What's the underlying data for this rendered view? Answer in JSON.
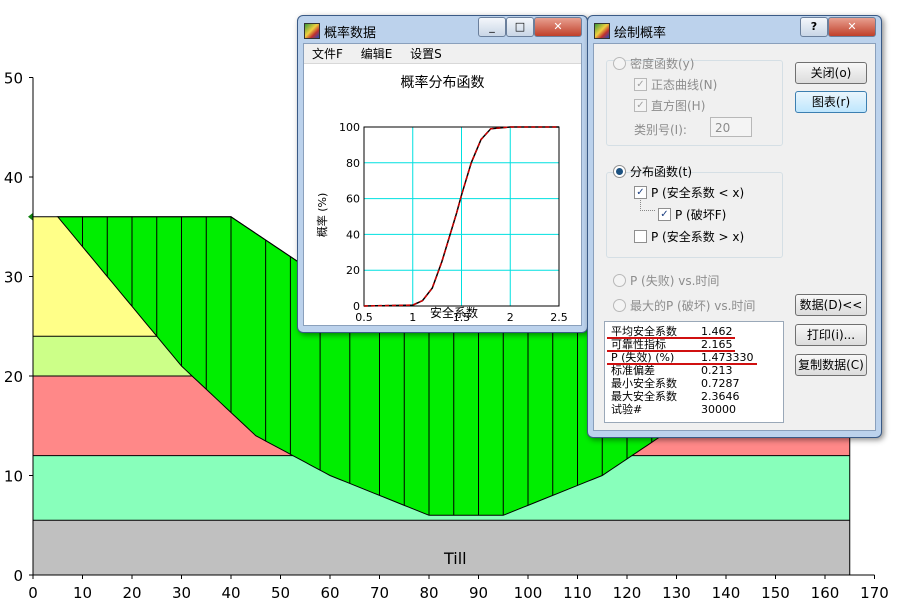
{
  "chart_data": {
    "type": "area",
    "x_ticks": [
      "0",
      "10",
      "20",
      "30",
      "40",
      "50",
      "60",
      "70",
      "80",
      "90",
      "100",
      "110",
      "120",
      "130",
      "140",
      "150",
      "160",
      "170"
    ],
    "y_ticks": [
      "0",
      "10",
      "20",
      "30",
      "40",
      "50"
    ],
    "xlim": [
      0,
      170
    ],
    "ylim": [
      0,
      50
    ],
    "layers": [
      {
        "color": "#ffff88",
        "top_y": 36
      },
      {
        "color": "#ccff88",
        "top_y": 24
      },
      {
        "color": "#ff8888",
        "top_y": 20
      },
      {
        "color": "#88ffbb",
        "top_y": 12
      },
      {
        "color": "#c0c0c0",
        "top_y": 5.5
      }
    ],
    "ground_surface": [
      [
        0,
        36
      ],
      [
        40,
        36
      ],
      [
        58,
        30
      ],
      [
        130,
        30
      ],
      [
        135,
        24
      ],
      [
        165,
        24
      ]
    ],
    "slip_surface": [
      [
        5,
        36
      ],
      [
        15,
        30
      ],
      [
        30,
        21
      ],
      [
        45,
        14
      ],
      [
        60,
        10
      ],
      [
        80,
        6
      ],
      [
        95,
        6
      ],
      [
        115,
        10
      ],
      [
        130,
        15
      ],
      [
        150,
        24
      ]
    ],
    "slice_x": [
      5,
      10,
      15,
      20,
      25,
      30,
      35,
      40,
      47,
      52,
      58,
      64,
      70,
      75,
      80,
      85,
      90,
      95,
      100,
      105,
      110,
      115,
      120,
      125,
      130,
      135,
      140,
      145,
      150
    ],
    "slip_color": "#00ee00",
    "bedrock_label": "Till",
    "cdf_chart": {
      "title": "概率分布函数",
      "xlabel": "安全系数",
      "ylabel": "概率 (%)",
      "x_ticks": [
        "0.5",
        "1",
        "1.5",
        "2",
        "2.5"
      ],
      "y_ticks": [
        "0",
        "20",
        "40",
        "60",
        "80",
        "100"
      ],
      "xlim": [
        0.5,
        2.5
      ],
      "ylim": [
        0,
        100
      ],
      "series": [
        {
          "color": "#cc0000",
          "points": [
            [
              0.5,
              0
            ],
            [
              1.0,
              0.5
            ],
            [
              1.1,
              3
            ],
            [
              1.2,
              10
            ],
            [
              1.3,
              25
            ],
            [
              1.4,
              43
            ],
            [
              1.45,
              52
            ],
            [
              1.5,
              62
            ],
            [
              1.6,
              80
            ],
            [
              1.7,
              93
            ],
            [
              1.8,
              99
            ],
            [
              2.0,
              100
            ],
            [
              2.5,
              100
            ]
          ]
        }
      ]
    }
  },
  "prob_window": {
    "title": "概率数据",
    "menu": [
      "文件F",
      "编辑E",
      "设置S"
    ]
  },
  "plot_window": {
    "title": "绘制概率",
    "help": "?",
    "density_radio": "密度函数(y)",
    "normal_curve": "正态曲线(N)",
    "histogram": "直方图(H)",
    "class_count_label": "类别号(I):",
    "class_count_value": "20",
    "dist_radio": "分布函数(t)",
    "p_fs_lt_x": "P (安全系数 < x)",
    "p_fail": "P (破坏F)",
    "p_fs_gt_x": "P (安全系数 > x)",
    "p_fail_vs_time": "P (失败) vs.时间",
    "max_p_fail_vs_time": "最大的P (破坏) vs.时间",
    "buttons": {
      "close": "关闭(o)",
      "chart": "图表(r)",
      "data": "数据(D)<<",
      "print": "打印(i)...",
      "copy": "复制数据(C)"
    },
    "stats": [
      {
        "label": "平均安全系数",
        "value": "1.462"
      },
      {
        "label": "可靠性指标",
        "value": "2.165"
      },
      {
        "label": "P (失效) (%)",
        "value": "1.473330"
      },
      {
        "label": "标准偏差",
        "value": "0.213"
      },
      {
        "label": "最小安全系数",
        "value": "0.7287"
      },
      {
        "label": "最大安全系数",
        "value": "2.3646"
      },
      {
        "label": "试验#",
        "value": "30000"
      }
    ]
  }
}
